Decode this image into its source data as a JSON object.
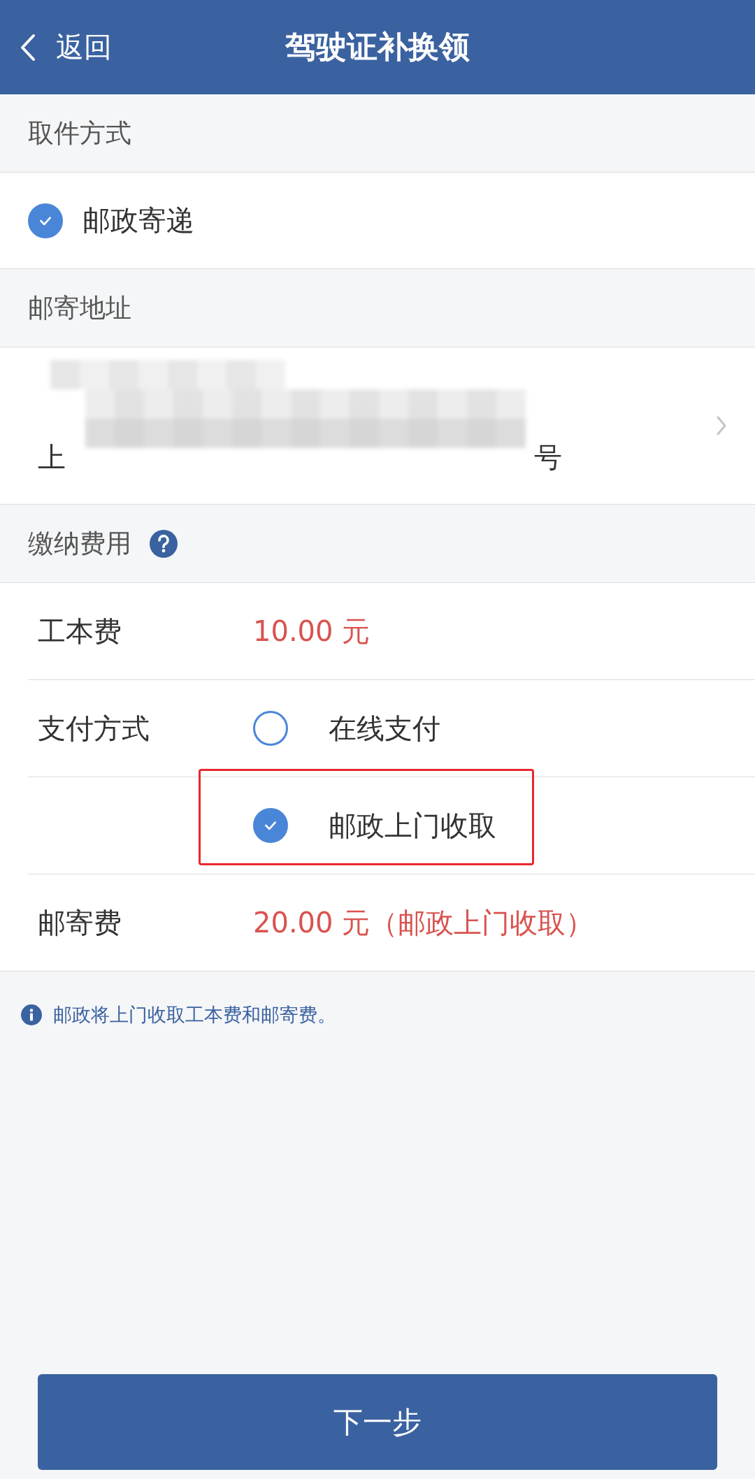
{
  "nav": {
    "back": "返回",
    "title": "驾驶证补换领"
  },
  "pickup": {
    "heading": "取件方式",
    "options": [
      {
        "label": "邮政寄递",
        "selected": true
      }
    ]
  },
  "address": {
    "heading": "邮寄地址",
    "line_start": "上",
    "line_end": "号"
  },
  "fees": {
    "heading": "缴纳费用",
    "rows": [
      {
        "kind": "fee",
        "label": "工本费",
        "value": "10.00 元"
      },
      {
        "kind": "payment",
        "label": "支付方式",
        "options": [
          {
            "label": "在线支付",
            "selected": false
          },
          {
            "label": "邮政上门收取",
            "selected": true,
            "highlighted": true
          }
        ]
      },
      {
        "kind": "fee",
        "label": "邮寄费",
        "value": "20.00 元（邮政上门收取）"
      }
    ]
  },
  "note": "邮政将上门收取工本费和邮寄费。",
  "next_button": "下一步"
}
